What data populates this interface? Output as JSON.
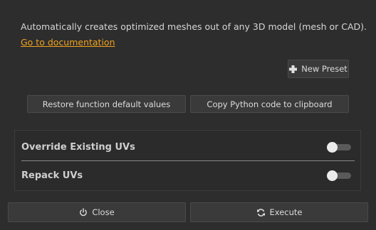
{
  "header": {
    "description": "Automatically creates optimized meshes out of any 3D model (mesh or CAD).",
    "doc_link": "Go to documentation"
  },
  "presets": {
    "new_preset_label": "New Preset",
    "new_preset_icon": "plus-icon"
  },
  "actions": {
    "restore_label": "Restore function default values",
    "copy_label": "Copy Python code to clipboard"
  },
  "options": [
    {
      "label": "Override Existing UVs",
      "enabled": false
    },
    {
      "label": "Repack UVs",
      "enabled": false
    }
  ],
  "footer": {
    "close_label": "Close",
    "close_icon": "power-icon",
    "execute_label": "Execute",
    "execute_icon": "refresh-icon"
  },
  "colors": {
    "background": "#2d2d2d",
    "link": "#f0a21e",
    "button": "#3a3a3a"
  }
}
